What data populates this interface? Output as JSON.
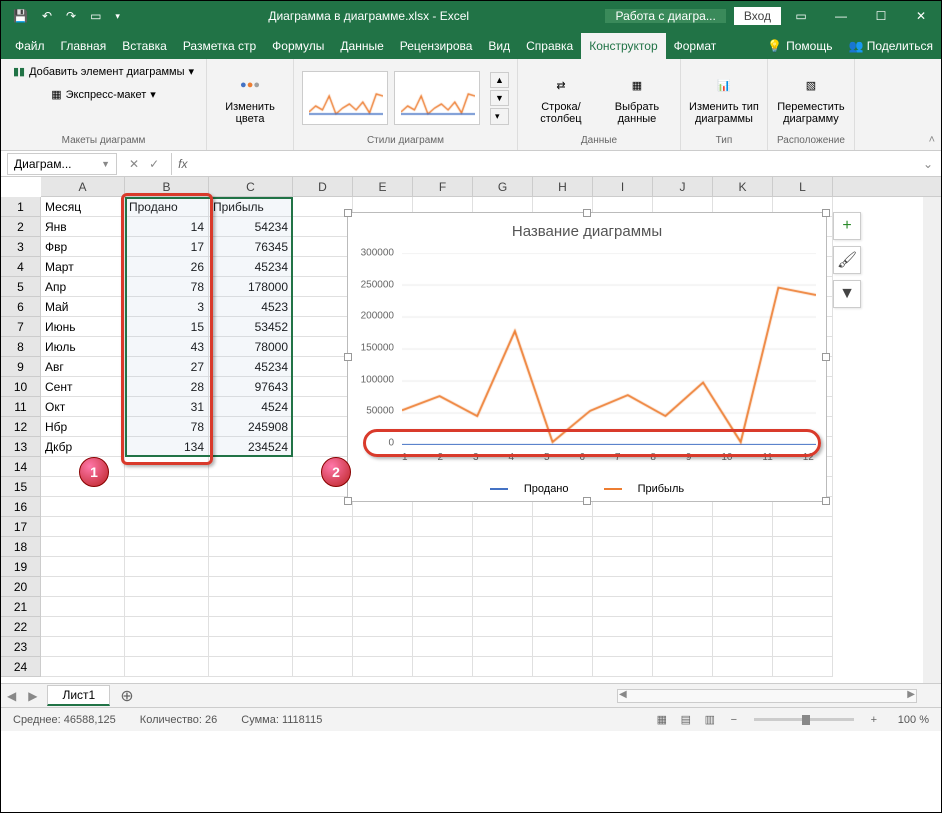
{
  "titlebar": {
    "filename": "Диаграмма в диаграмме.xlsx - Excel",
    "contextual": "Работа с диагра...",
    "signin": "Вход"
  },
  "tabs": {
    "file": "Файл",
    "home": "Главная",
    "insert": "Вставка",
    "layout": "Разметка стр",
    "formulas": "Формулы",
    "data": "Данные",
    "review": "Рецензирова",
    "view": "Вид",
    "help": "Справка",
    "design": "Конструктор",
    "format": "Формат",
    "tell_me": "Помощь",
    "share": "Поделиться"
  },
  "ribbon": {
    "layouts": {
      "add_element": "Добавить элемент диаграммы",
      "quick_layout": "Экспресс-макет",
      "label": "Макеты диаграмм"
    },
    "colors": {
      "change": "Изменить\nцвета"
    },
    "styles": {
      "label": "Стили диаграмм"
    },
    "data_group": {
      "switch": "Строка/\nстолбец",
      "select": "Выбрать\nданные",
      "label": "Данные"
    },
    "type": {
      "change": "Изменить тип\nдиаграммы",
      "label": "Тип"
    },
    "loc": {
      "move": "Переместить\nдиаграмму",
      "label": "Расположение"
    }
  },
  "namebox": "Диаграм...",
  "fx": "fx",
  "columns": [
    "A",
    "B",
    "C",
    "D",
    "E",
    "F",
    "G",
    "H",
    "I",
    "J",
    "K",
    "L"
  ],
  "rows": [
    1,
    2,
    3,
    4,
    5,
    6,
    7,
    8,
    9,
    10,
    11,
    12,
    13,
    14,
    15,
    16,
    17,
    18,
    19,
    20,
    21,
    22,
    23,
    24
  ],
  "headers": {
    "a": "Месяц",
    "b": "Продано",
    "c": "Прибыль"
  },
  "table": [
    {
      "month": "Янв",
      "sold": 14,
      "profit": 54234
    },
    {
      "month": "Фвр",
      "sold": 17,
      "profit": 76345
    },
    {
      "month": "Март",
      "sold": 26,
      "profit": 45234
    },
    {
      "month": "Апр",
      "sold": 78,
      "profit": 178000
    },
    {
      "month": "Май",
      "sold": 3,
      "profit": 4523
    },
    {
      "month": "Июнь",
      "sold": 15,
      "profit": 53452
    },
    {
      "month": "Июль",
      "sold": 43,
      "profit": 78000
    },
    {
      "month": "Авг",
      "sold": 27,
      "profit": 45234
    },
    {
      "month": "Сент",
      "sold": 28,
      "profit": 97643
    },
    {
      "month": "Окт",
      "sold": 31,
      "profit": 4524
    },
    {
      "month": "Нбр",
      "sold": 78,
      "profit": 245908
    },
    {
      "month": "Дкбр",
      "sold": 134,
      "profit": 234524
    }
  ],
  "chart": {
    "title": "Название диаграммы",
    "legend": {
      "s1": "Продано",
      "s2": "Прибыль"
    }
  },
  "chart_data": {
    "type": "line",
    "title": "Название диаграммы",
    "xlabel": "",
    "ylabel": "",
    "x": [
      1,
      2,
      3,
      4,
      5,
      6,
      7,
      8,
      9,
      10,
      11,
      12
    ],
    "ylim": [
      0,
      300000
    ],
    "yticks": [
      0,
      50000,
      100000,
      150000,
      200000,
      250000,
      300000
    ],
    "series": [
      {
        "name": "Продано",
        "color": "#4472c4",
        "values": [
          14,
          17,
          26,
          78,
          3,
          15,
          43,
          27,
          28,
          31,
          78,
          134
        ]
      },
      {
        "name": "Прибыль",
        "color": "#ed7d31",
        "values": [
          54234,
          76345,
          45234,
          178000,
          4523,
          53452,
          78000,
          45234,
          97643,
          4524,
          245908,
          234524
        ]
      }
    ]
  },
  "sheet_tab": "Лист1",
  "status": {
    "avg_label": "Среднее:",
    "avg": "46588,125",
    "count_label": "Количество:",
    "count": "26",
    "sum_label": "Сумма:",
    "sum": "1118115",
    "zoom": "100 %"
  },
  "callouts": {
    "one": "1",
    "two": "2"
  }
}
